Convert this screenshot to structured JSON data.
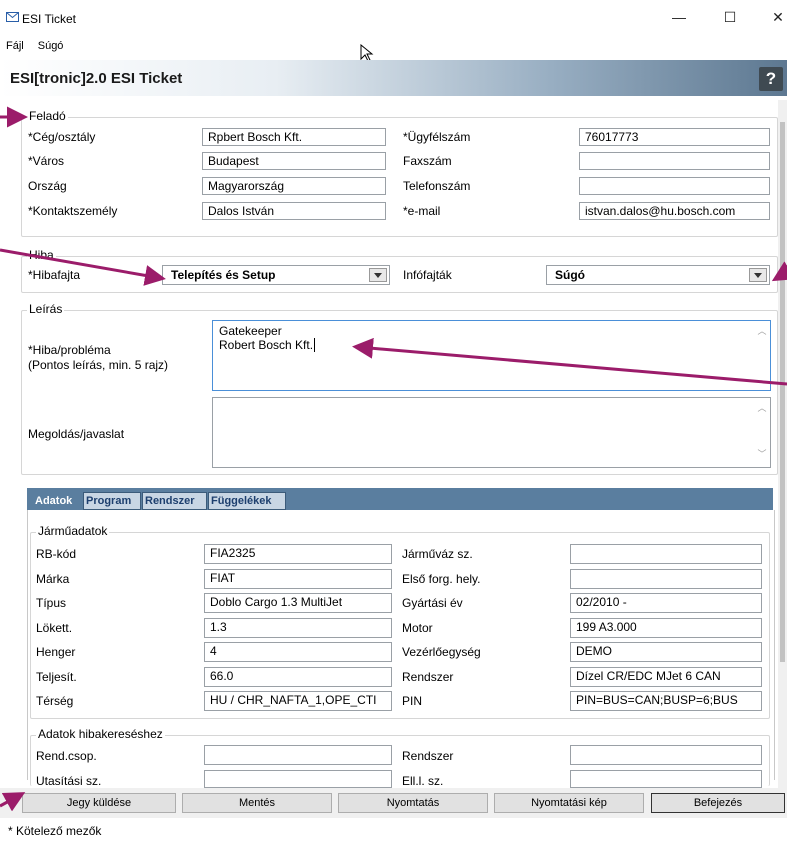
{
  "window": {
    "title": "ESI Ticket",
    "minimize": "—",
    "maximize": "☐",
    "close": "✕"
  },
  "menu": [
    "Fájl",
    "Súgó"
  ],
  "header": {
    "title": "ESI[tronic]2.0 ESI Ticket",
    "help": "?"
  },
  "felado": {
    "legend": "Feladó",
    "rows": [
      {
        "l1": "*Cég/osztály",
        "v1": "Rpbert Bosch Kft.",
        "l2": "*Ügyfélszám",
        "v2": "76017773"
      },
      {
        "l1": "*Város",
        "v1": "Budapest",
        "l2": "Faxszám",
        "v2": ""
      },
      {
        "l1": "Ország",
        "v1": "Magyarország",
        "l2": "Telefonszám",
        "v2": ""
      },
      {
        "l1": "*Kontaktszemély",
        "v1": "Dalos István",
        "l2": "*e-mail",
        "v2": "istvan.dalos@hu.bosch.com"
      }
    ]
  },
  "hiba": {
    "legend": "Hiba",
    "type_label": "*Hibafajta",
    "type_value": "Telepítés és Setup",
    "info_label": "Infófajták",
    "info_value": "Súgó"
  },
  "leiras": {
    "legend": "Leírás",
    "problem_label_1": "*Hiba/probléma",
    "problem_label_2": "(Pontos leírás, min. 5 rajz)",
    "problem_line_1": "Gatekeeper",
    "problem_line_2": "Robert Bosch Kft.",
    "solution_label": "Megoldás/javaslat",
    "solution_value": ""
  },
  "tabs": [
    "Adatok",
    "Program",
    "Rendszer",
    "Függelékek"
  ],
  "jarmu": {
    "legend": "Járműadatok",
    "rows": [
      {
        "l1": "RB-kód",
        "v1": "FIA2325",
        "l2": "Járműváz sz.",
        "v2": ""
      },
      {
        "l1": "Márka",
        "v1": "FIAT",
        "l2": "Első forg. hely.",
        "v2": ""
      },
      {
        "l1": "Típus",
        "v1": "Doblo Cargo 1.3 MultiJet",
        "l2": "Gyártási év",
        "v2": "02/2010 -"
      },
      {
        "l1": "Lökett.",
        "v1": "1.3",
        "l2": "Motor",
        "v2": "199 A3.000"
      },
      {
        "l1": "Henger",
        "v1": "4",
        "l2": "Vezérlőegység",
        "v2": "DEMO"
      },
      {
        "l1": "Teljesít.",
        "v1": "66.0",
        "l2": "Rendszer",
        "v2": "Dízel CR/EDC MJet 6 CAN"
      },
      {
        "l1": "Térség",
        "v1": "HU / CHR_NAFTA_1,OPE_CTI",
        "l2": "PIN",
        "v2": "PIN=BUS=CAN;BUSP=6;BUS"
      }
    ]
  },
  "hibakereses": {
    "legend": "Adatok hibakereséshez",
    "rows": [
      {
        "l1": "Rend.csop.",
        "v1": "",
        "l2": "Rendszer",
        "v2": ""
      },
      {
        "l1": "Utasítási sz.",
        "v1": "",
        "l2": "Ell.l. sz.",
        "v2": ""
      }
    ]
  },
  "buttons": [
    "Jegy küldése",
    "Mentés",
    "Nyomtatás",
    "Nyomtatási kép",
    "Befejezés"
  ],
  "footer": "* Kötelező mezők",
  "colors": {
    "annotation": "#9b1c6a",
    "tabbar": "#5a7e9f"
  }
}
